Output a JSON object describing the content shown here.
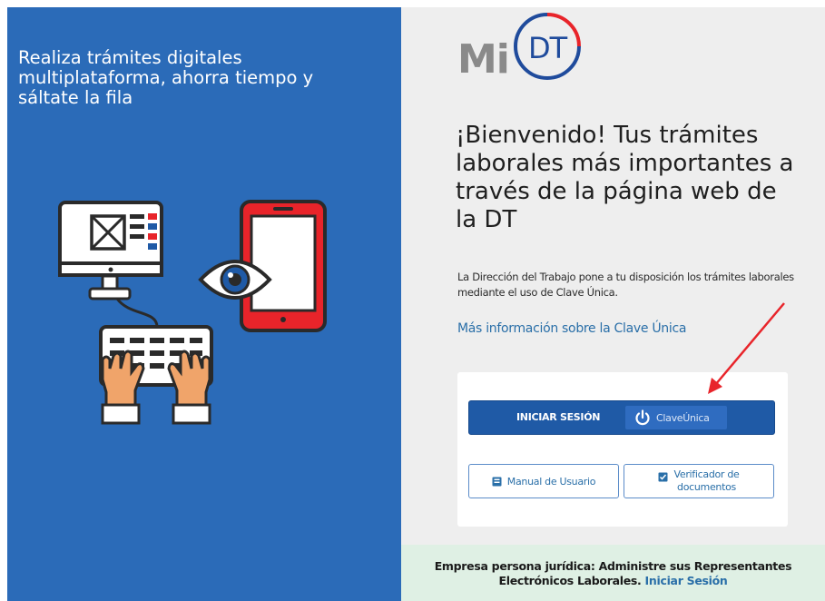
{
  "left": {
    "headline": "Realiza trámites digitales multiplataforma, ahorra tiempo y sáltate la fila"
  },
  "logo": {
    "mi": "Mi",
    "dt": "DT"
  },
  "welcome": {
    "title": "¡Bienvenido! Tus trámites laborales más importantes a través de la página web de la DT",
    "description": "La Dirección del Trabajo pone a tu disposición los trámites laborales mediante el uso de Clave Única.",
    "more_info_link": "Más información sobre la Clave Única"
  },
  "login": {
    "button_label": "INICIAR SESIÓN",
    "provider_label": "ClaveÚnica",
    "manual_label": "Manual de Usuario",
    "verify_label_line1": "Verificador de",
    "verify_label_line2": "documentos"
  },
  "footer": {
    "text_line1": "Empresa persona jurídica: Administre sus Representantes",
    "text_line2": "Electrónicos Laborales.",
    "link": "Iniciar Sesión"
  },
  "colors": {
    "left_panel": "#2b6bb8",
    "right_panel": "#eeeeee",
    "primary_button": "#1f5aa6",
    "link": "#2a6fa8",
    "footer_bg": "#dff0e4",
    "annotation_arrow": "#e8242a"
  },
  "icons": {
    "illustration": [
      "computer-icon",
      "keyboard-icon",
      "typing-hands-icon",
      "eye-icon",
      "tablet-icon"
    ],
    "login": "power-icon",
    "manual": "book-icon",
    "verify": "document-check-icon"
  }
}
